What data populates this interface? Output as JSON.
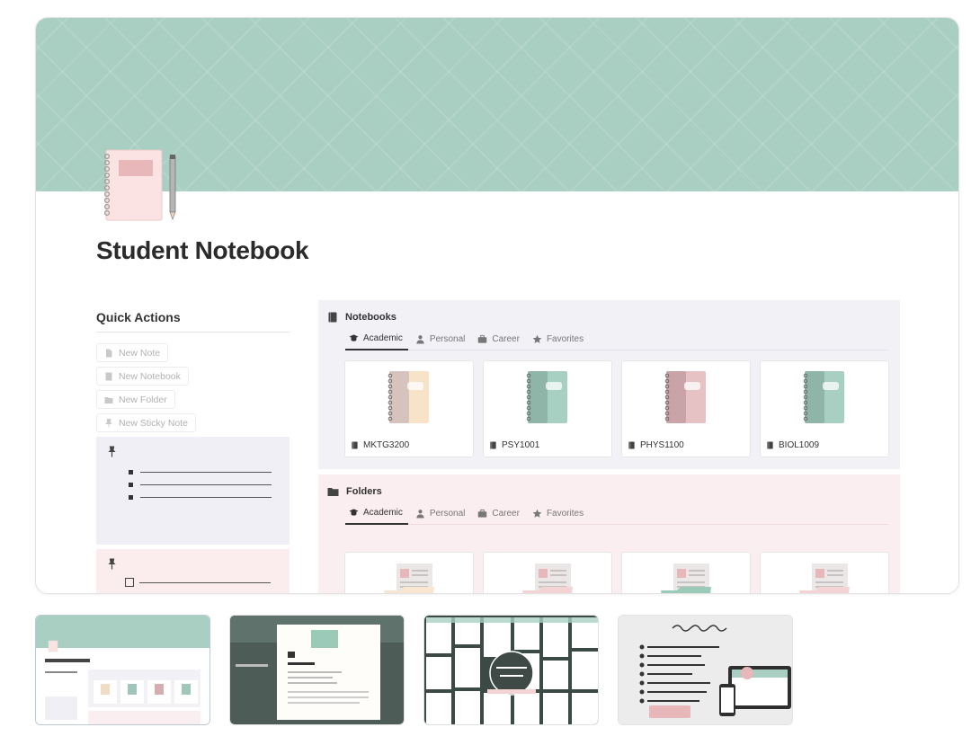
{
  "page": {
    "title": "Student Notebook",
    "cover_color": "#a9cfc3"
  },
  "quick_actions": {
    "title": "Quick Actions",
    "buttons": [
      {
        "label": "New Note",
        "icon": "note-icon"
      },
      {
        "label": "New Notebook",
        "icon": "notebook-icon"
      },
      {
        "label": "New Folder",
        "icon": "folder-icon"
      },
      {
        "label": "New Sticky Note",
        "icon": "pin-icon"
      }
    ]
  },
  "notebooks": {
    "title": "Notebooks",
    "tabs": [
      {
        "label": "Academic",
        "icon": "graduation-cap-icon",
        "active": true
      },
      {
        "label": "Personal",
        "icon": "person-icon",
        "active": false
      },
      {
        "label": "Career",
        "icon": "briefcase-icon",
        "active": false
      },
      {
        "label": "Favorites",
        "icon": "star-icon",
        "active": false
      }
    ],
    "cards": [
      {
        "label": "MKTG3200",
        "color_a": "#d6c3bd",
        "color_b": "#f6e3c8"
      },
      {
        "label": "PSY1001",
        "color_a": "#8fb5a9",
        "color_b": "#a7cfc2"
      },
      {
        "label": "PHYS1100",
        "color_a": "#c9a3a7",
        "color_b": "#e7c2c5"
      },
      {
        "label": "BIOL1009",
        "color_a": "#8fb5a9",
        "color_b": "#a7cfc2"
      }
    ]
  },
  "folders": {
    "title": "Folders",
    "tabs": [
      {
        "label": "Academic",
        "icon": "graduation-cap-icon",
        "active": true
      },
      {
        "label": "Personal",
        "icon": "person-icon",
        "active": false
      },
      {
        "label": "Career",
        "icon": "briefcase-icon",
        "active": false
      },
      {
        "label": "Favorites",
        "icon": "star-icon",
        "active": false
      }
    ],
    "cards": [
      {
        "color": "#f8e6d0"
      },
      {
        "color": "#f4d3d4"
      },
      {
        "color": "#9ccab9"
      },
      {
        "color": "#f4d3d4"
      }
    ]
  }
}
